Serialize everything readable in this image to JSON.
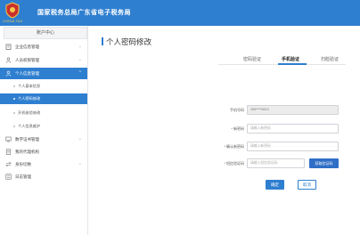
{
  "header": {
    "title": "国家税务总局广东省电子税务局",
    "logo_text": "CHINA TAX"
  },
  "sidebar": {
    "user_center": "账户中心",
    "items": [
      {
        "label": "企业信息管理",
        "icon": "building-icon"
      },
      {
        "label": "人员权限管理",
        "icon": "user-icon"
      },
      {
        "label": "个人信息管理",
        "icon": "user-icon",
        "active": true
      },
      {
        "label": "数字证书管理",
        "icon": "certificate-icon"
      },
      {
        "label": "我的代理机构",
        "icon": "document-icon"
      },
      {
        "label": "身份切换",
        "icon": "switch-icon"
      },
      {
        "label": "日志管理",
        "icon": "log-icon"
      }
    ],
    "sub_items": [
      {
        "label": "个人基本信息"
      },
      {
        "label": "个人密码修改",
        "current": true
      },
      {
        "label": "开机核验修改"
      },
      {
        "label": "个人信息维护"
      }
    ]
  },
  "main": {
    "page_title": "个人密码修改",
    "tabs": [
      {
        "label": "密码验证"
      },
      {
        "label": "手机验证",
        "active": true
      },
      {
        "label": "扫脸验证"
      }
    ],
    "form": {
      "phone_label": "手机号码",
      "phone_value": "159****0813",
      "new_password_label": "* 新密码",
      "new_password_placeholder": "请输入新密码",
      "confirm_password_label": "* 确认新密码",
      "confirm_password_placeholder": "请输入新密码",
      "sms_code_label": "* 短信验证码",
      "sms_code_placeholder": "请输入短信验证码",
      "get_code_button": "获取验证码"
    },
    "actions": {
      "confirm_label": "确定",
      "cancel_label": "取消"
    }
  },
  "colors": {
    "brand_blue": "#2f7fd0",
    "sidebar_active": "#2f7fd0",
    "readonly_bg": "#ececec"
  }
}
